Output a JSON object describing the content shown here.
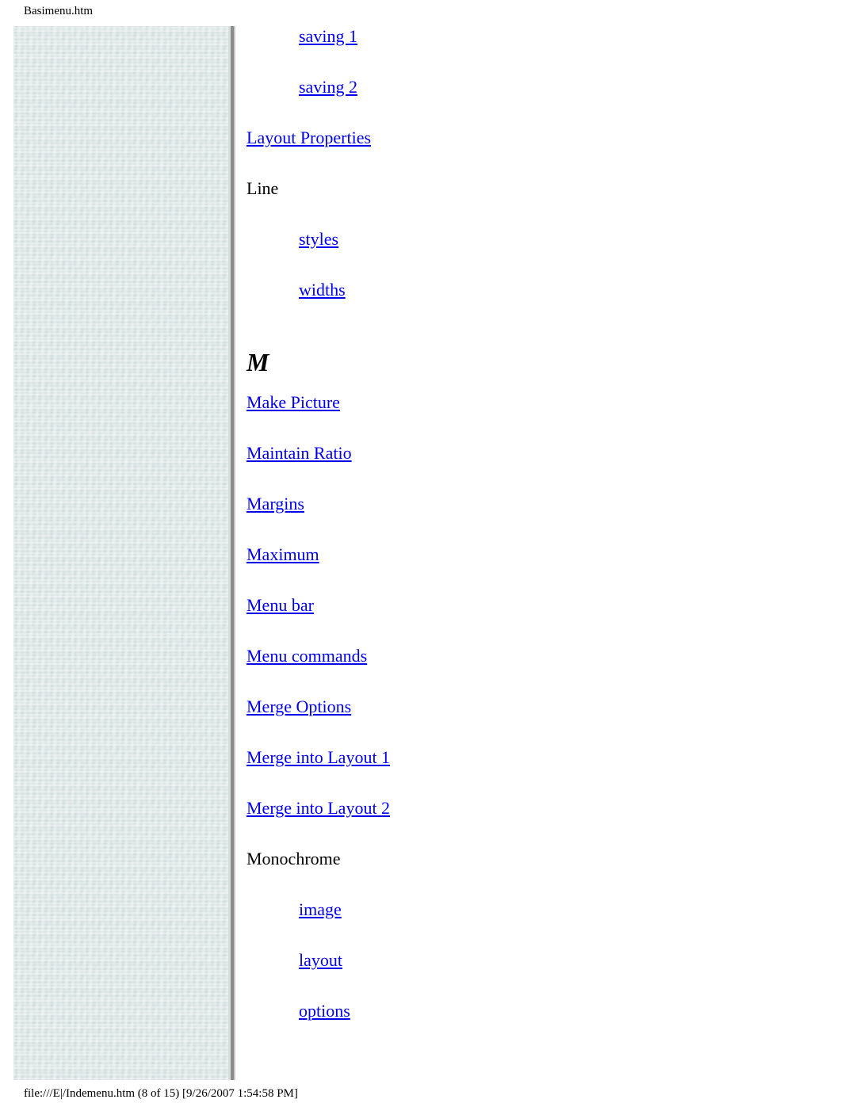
{
  "header": {
    "title": "Basimenu.htm"
  },
  "footer": {
    "path_line": "file:///E|/Indemenu.htm (8 of 15) [9/26/2007 1:54:58 PM]"
  },
  "sidebar": {
    "kind": "decorative-texture-strip",
    "base_color": "#cfdcdc",
    "border_color": "#8c8c8c"
  },
  "theme": {
    "link_color": "#0000ee",
    "text_color": "#000000",
    "page_background": "#ffffff"
  },
  "index": {
    "entries": [
      {
        "label": "saving 1",
        "level": 2,
        "link": true
      },
      {
        "label": "saving 2",
        "level": 2,
        "link": true
      },
      {
        "label": "Layout Properties",
        "level": 1,
        "link": true
      },
      {
        "label": "Line",
        "level": 1,
        "link": false
      },
      {
        "label": "styles",
        "level": 2,
        "link": true
      },
      {
        "label": "widths",
        "level": 2,
        "link": true
      }
    ],
    "letter_heading": "M",
    "entries_after_heading": [
      {
        "label": "Make Picture",
        "level": 1,
        "link": true
      },
      {
        "label": "Maintain Ratio",
        "level": 1,
        "link": true
      },
      {
        "label": "Margins",
        "level": 1,
        "link": true
      },
      {
        "label": "Maximum",
        "level": 1,
        "link": true
      },
      {
        "label": "Menu bar",
        "level": 1,
        "link": true
      },
      {
        "label": "Menu commands",
        "level": 1,
        "link": true
      },
      {
        "label": "Merge Options",
        "level": 1,
        "link": true
      },
      {
        "label": "Merge into Layout 1",
        "level": 1,
        "link": true
      },
      {
        "label": "Merge into Layout 2",
        "level": 1,
        "link": true
      },
      {
        "label": "Monochrome",
        "level": 1,
        "link": false
      },
      {
        "label": "image",
        "level": 2,
        "link": true
      },
      {
        "label": "layout",
        "level": 2,
        "link": true
      },
      {
        "label": "options",
        "level": 2,
        "link": true
      }
    ]
  }
}
